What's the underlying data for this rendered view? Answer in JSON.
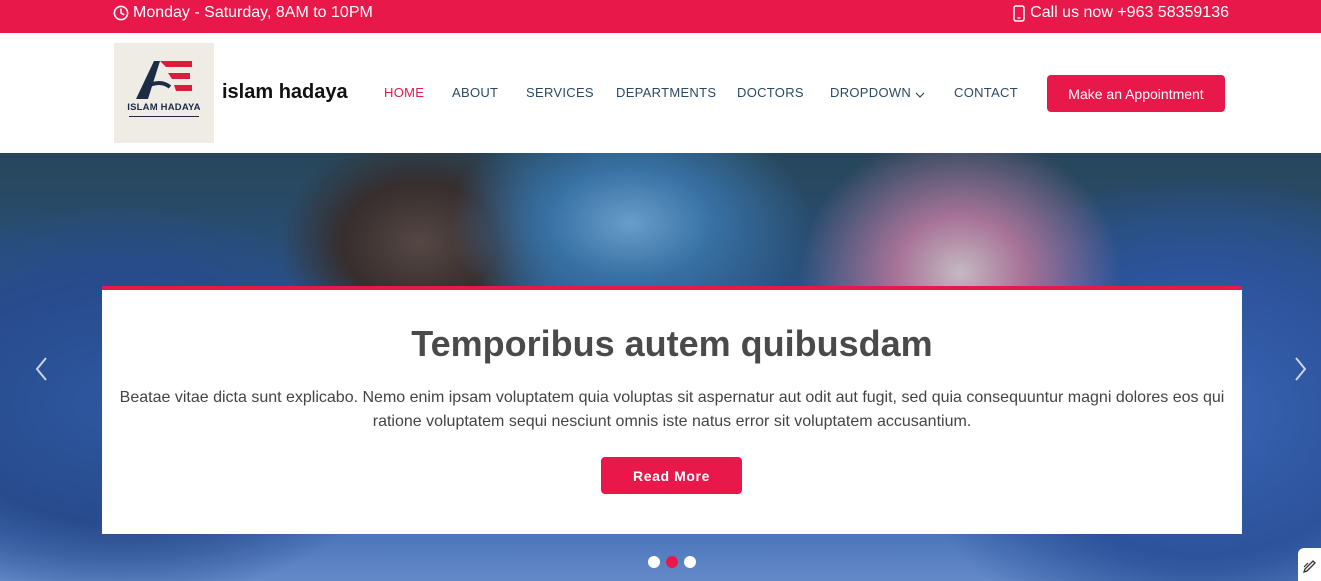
{
  "topbar": {
    "hours": "Monday - Saturday, 8AM to 10PM",
    "phone": "Call us now +963 58359136",
    "icons": [
      "clock-icon",
      "phone-icon"
    ],
    "color": "#e8194a"
  },
  "header": {
    "logo_text": "ISLAM HADAYA",
    "site_name": "islam hadaya",
    "nav": [
      {
        "label": "HOME",
        "active": true
      },
      {
        "label": "ABOUT"
      },
      {
        "label": "SERVICES"
      },
      {
        "label": "DEPARTMENTS"
      },
      {
        "label": "DOCTORS"
      },
      {
        "label": "DROPDOWN",
        "has_dropdown": true
      },
      {
        "label": "CONTACT"
      }
    ],
    "cta": "Make an Appointment"
  },
  "hero": {
    "title": "Temporibus autem quibusdam",
    "text": "Beatae vitae dicta sunt explicabo. Nemo enim ipsam voluptatem quia voluptas sit aspernatur aut odit aut fugit, sed quia consequuntur magni dolores eos qui ratione voluptatem sequi nesciunt omnis iste natus error sit voluptatem accusantium.",
    "button": "Read More",
    "slides_total": 3,
    "active_slide": 2,
    "accent": "#e8194a"
  }
}
